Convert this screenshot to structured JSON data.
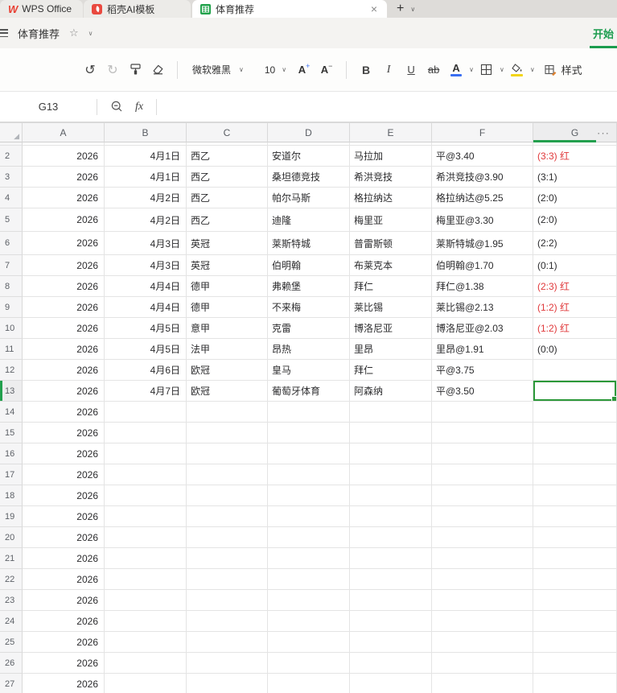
{
  "window_tabs": [
    {
      "label": "WPS Office"
    },
    {
      "label": "稻壳AI模板"
    },
    {
      "label": "体育推荐"
    }
  ],
  "title_bar": {
    "doc_title": "体育推荐"
  },
  "ribbon": {
    "active_tab": "开始"
  },
  "toolbar": {
    "font_name": "微软雅黑",
    "font_size": "10",
    "bold": "B",
    "italic": "I",
    "underline": "U",
    "strikethrough": "ab",
    "font_color_letter": "A",
    "grow_letter": "A",
    "shrink_letter": "A",
    "styles_label": "样式"
  },
  "formula_bar": {
    "cell_ref": "G13",
    "fx_label": "fx"
  },
  "colors": {
    "accent_green": "#23a04e",
    "alert_red": "#e0393b"
  },
  "sheet": {
    "column_headers": [
      "A",
      "B",
      "C",
      "D",
      "E",
      "F",
      "G"
    ],
    "more_columns": "···",
    "selected_cell": "G13",
    "rows": [
      {
        "n": 2,
        "cells": [
          "2026",
          "4月1日",
          "西乙",
          "安道尔",
          "马拉加",
          "平@3.40",
          "(3:3) 红"
        ],
        "g_red": true
      },
      {
        "n": 3,
        "cells": [
          "2026",
          "4月1日",
          "西乙",
          "桑坦德竞技",
          "希洪竞技",
          "希洪竞技@3.90",
          "(3:1)"
        ]
      },
      {
        "n": 4,
        "cells": [
          "2026",
          "4月2日",
          "西乙",
          "帕尔马斯",
          "格拉纳达",
          "格拉纳达@5.25",
          "(2:0)"
        ]
      },
      {
        "n": 5,
        "cells": [
          "2026",
          "4月2日",
          "西乙",
          "迪隆",
          "梅里亚",
          "梅里亚@3.30",
          "(2:0)"
        ]
      },
      {
        "n": 6,
        "cells": [
          "2026",
          "4月3日",
          "英冠",
          "莱斯特城",
          "普雷斯顿",
          "莱斯特城@1.95",
          "(2:2)"
        ]
      },
      {
        "n": 7,
        "cells": [
          "2026",
          "4月3日",
          "英冠",
          "伯明翰",
          "布莱克本",
          "伯明翰@1.70",
          "(0:1)"
        ]
      },
      {
        "n": 8,
        "cells": [
          "2026",
          "4月4日",
          "德甲",
          "弗赖堡",
          "拜仁",
          "拜仁@1.38",
          "(2:3) 红"
        ],
        "g_red": true
      },
      {
        "n": 9,
        "cells": [
          "2026",
          "4月4日",
          "德甲",
          "不来梅",
          "莱比锡",
          "莱比锡@2.13",
          "(1:2) 红"
        ],
        "g_red": true
      },
      {
        "n": 10,
        "cells": [
          "2026",
          "4月5日",
          "意甲",
          "克雷",
          "博洛尼亚",
          "博洛尼亚@2.03",
          "(1:2) 红"
        ],
        "g_red": true
      },
      {
        "n": 11,
        "cells": [
          "2026",
          "4月5日",
          "法甲",
          "昂热",
          "里昂",
          "里昂@1.91",
          "(0:0)"
        ]
      },
      {
        "n": 12,
        "cells": [
          "2026",
          "4月6日",
          "欧冠",
          "皇马",
          "拜仁",
          "平@3.75",
          ""
        ]
      },
      {
        "n": 13,
        "cells": [
          "2026",
          "4月7日",
          "欧冠",
          "葡萄牙体育",
          "阿森纳",
          "平@3.50",
          ""
        ],
        "selected": true
      },
      {
        "n": 14,
        "cells": [
          "2026",
          "",
          "",
          "",
          "",
          "",
          ""
        ]
      },
      {
        "n": 15,
        "cells": [
          "2026",
          "",
          "",
          "",
          "",
          "",
          ""
        ]
      },
      {
        "n": 16,
        "cells": [
          "2026",
          "",
          "",
          "",
          "",
          "",
          ""
        ]
      },
      {
        "n": 17,
        "cells": [
          "2026",
          "",
          "",
          "",
          "",
          "",
          ""
        ]
      },
      {
        "n": 18,
        "cells": [
          "2026",
          "",
          "",
          "",
          "",
          "",
          ""
        ]
      },
      {
        "n": 19,
        "cells": [
          "2026",
          "",
          "",
          "",
          "",
          "",
          ""
        ]
      },
      {
        "n": 20,
        "cells": [
          "2026",
          "",
          "",
          "",
          "",
          "",
          ""
        ]
      },
      {
        "n": 21,
        "cells": [
          "2026",
          "",
          "",
          "",
          "",
          "",
          ""
        ]
      },
      {
        "n": 22,
        "cells": [
          "2026",
          "",
          "",
          "",
          "",
          "",
          ""
        ]
      },
      {
        "n": 23,
        "cells": [
          "2026",
          "",
          "",
          "",
          "",
          "",
          ""
        ]
      },
      {
        "n": 24,
        "cells": [
          "2026",
          "",
          "",
          "",
          "",
          "",
          ""
        ]
      },
      {
        "n": 25,
        "cells": [
          "2026",
          "",
          "",
          "",
          "",
          "",
          ""
        ]
      },
      {
        "n": 26,
        "cells": [
          "2026",
          "",
          "",
          "",
          "",
          "",
          ""
        ]
      },
      {
        "n": 27,
        "cells": [
          "2026",
          "",
          "",
          "",
          "",
          "",
          ""
        ]
      }
    ]
  }
}
